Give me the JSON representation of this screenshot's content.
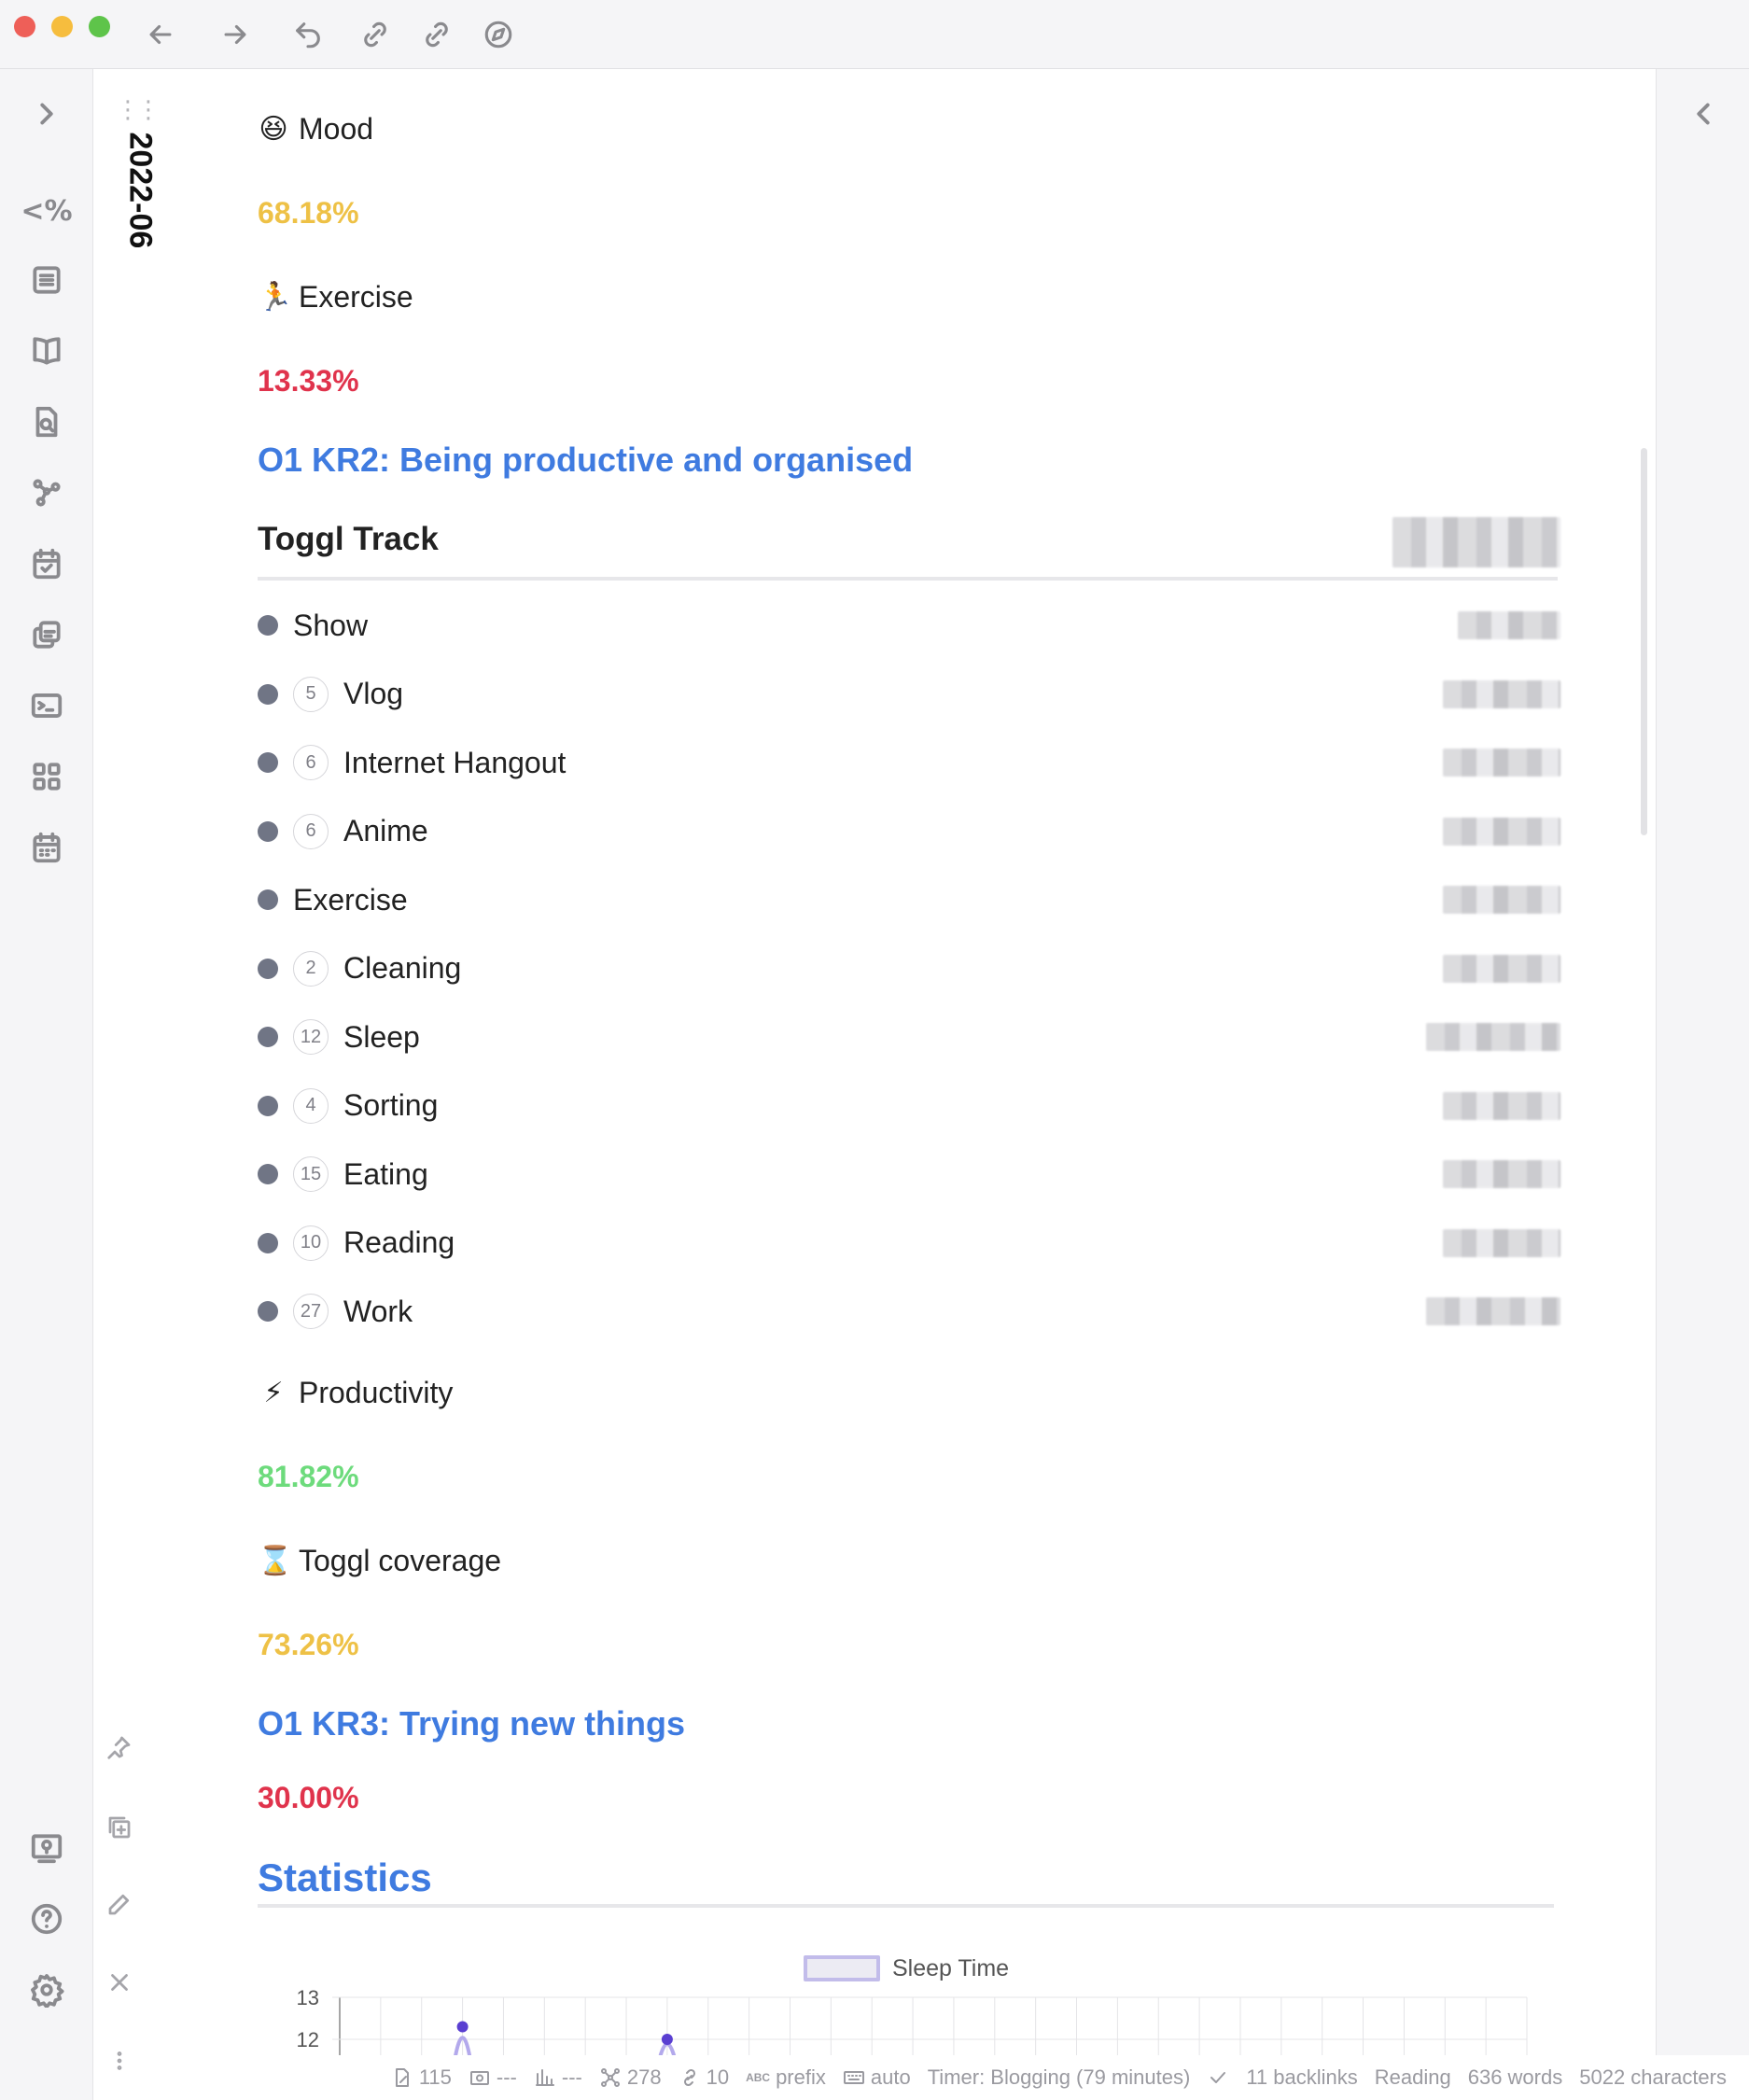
{
  "window": {
    "nav": [
      "back-arrow",
      "forward-arrow",
      "undo",
      "sync-link",
      "sync-link-2",
      "compass"
    ]
  },
  "ribbon": {
    "template_label": "<%",
    "icons": [
      "expand-chevron-icon",
      "templater-icon",
      "outline-icon",
      "book-icon",
      "search-document-icon",
      "graph-icon",
      "daily-note-icon",
      "copy-icon",
      "terminal-icon",
      "grid-apps-icon",
      "calendar-icon",
      "vault-icon",
      "help-icon",
      "settings-icon"
    ]
  },
  "tab": {
    "title": "2022-06"
  },
  "content": {
    "mood": {
      "emoji": "😆",
      "label": "Mood",
      "value": "68.18%"
    },
    "exercise": {
      "emoji": "🏃",
      "label": "Exercise",
      "value": "13.33%"
    },
    "kr2": "O1 KR2: Being productive and organised",
    "toggl_heading": "Toggl Track",
    "toggl_items": [
      {
        "label": "Show",
        "count": ""
      },
      {
        "label": "Vlog",
        "count": "5"
      },
      {
        "label": "Internet Hangout",
        "count": "6"
      },
      {
        "label": "Anime",
        "count": "6"
      },
      {
        "label": "Exercise",
        "count": ""
      },
      {
        "label": "Cleaning",
        "count": "2"
      },
      {
        "label": "Sleep",
        "count": "12"
      },
      {
        "label": "Sorting",
        "count": "4"
      },
      {
        "label": "Eating",
        "count": "15"
      },
      {
        "label": "Reading",
        "count": "10"
      },
      {
        "label": "Work",
        "count": "27"
      }
    ],
    "productivity": {
      "emoji": "⚡",
      "label": "Productivity",
      "value": "81.82%"
    },
    "toggl_coverage": {
      "emoji": "⌛",
      "label": "Toggl coverage",
      "value": "73.26%"
    },
    "kr3": "O1 KR3: Trying new things",
    "kr3_value": "30.00%",
    "statistics": "Statistics"
  },
  "chart_data": {
    "type": "line",
    "series": [
      {
        "name": "Sleep Time",
        "points": [
          {
            "x": 3,
            "y": 12.3
          },
          {
            "x": 8,
            "y": 12.0
          }
        ]
      }
    ],
    "y_ticks": [
      "13",
      "12"
    ],
    "grid": true,
    "legend_position": "top"
  },
  "statusbar": {
    "files": "115",
    "a": "---",
    "b": "---",
    "nodes": "278",
    "links": "10",
    "prefix": "prefix",
    "auto": "auto",
    "timer": "Timer: Blogging (79 minutes)",
    "backlinks": "11 backlinks",
    "mode": "Reading",
    "words": "636 words",
    "chars": "5022 characters"
  },
  "colors": {
    "accent_blue": "#3f7be0",
    "yellow": "#eec146",
    "red": "#e0334c",
    "green": "#6ddb7c"
  }
}
